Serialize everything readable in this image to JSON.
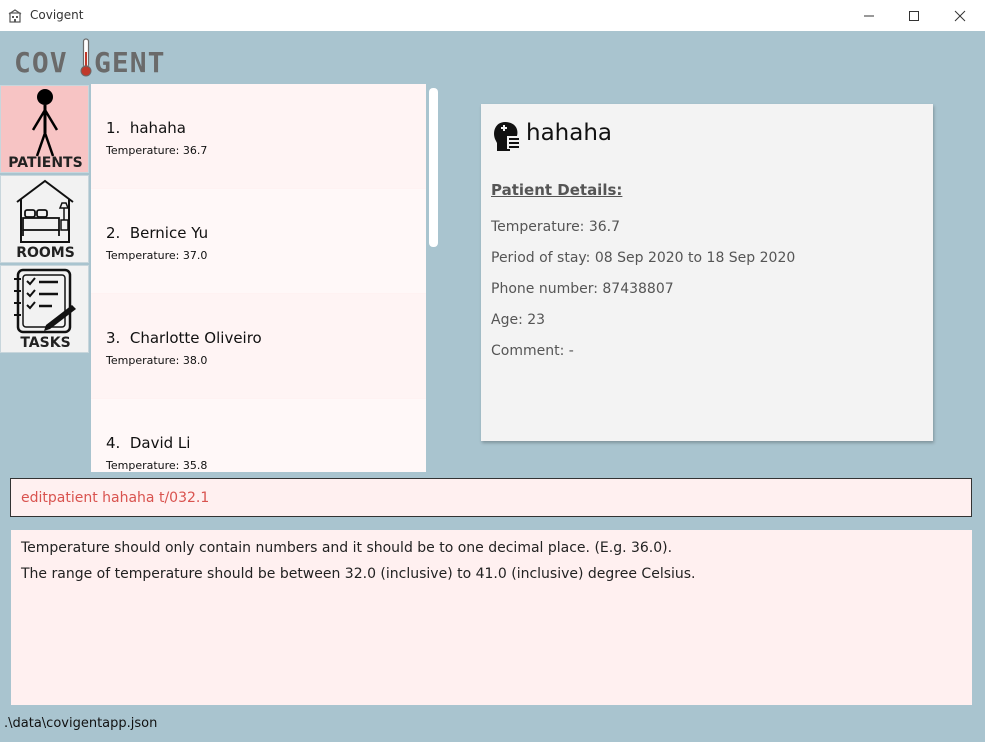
{
  "window": {
    "title": "Covigent",
    "icon": "building-icon",
    "controls": [
      "minimize-icon",
      "maximize-icon",
      "close-icon"
    ]
  },
  "logo": {
    "text_left": "COV",
    "text_right": "GENT",
    "icon": "thermometer-icon"
  },
  "sidebar": {
    "items": [
      {
        "label": "PATIENTS",
        "icon": "person-icon",
        "active": true
      },
      {
        "label": "ROOMS",
        "icon": "bed-room-icon",
        "active": false
      },
      {
        "label": "TASKS",
        "icon": "checklist-icon",
        "active": false
      }
    ]
  },
  "patients": [
    {
      "index": "1.",
      "name": "hahaha",
      "temperature": "Temperature: 36.7"
    },
    {
      "index": "2.",
      "name": "Bernice Yu",
      "temperature": "Temperature: 37.0"
    },
    {
      "index": "3.",
      "name": "Charlotte Oliveiro",
      "temperature": "Temperature: 38.0"
    },
    {
      "index": "4.",
      "name": "David Li",
      "temperature": "Temperature: 35.8"
    }
  ],
  "detail": {
    "icon": "patient-head-icon",
    "name": "hahaha",
    "heading": "Patient Details:",
    "temperature": "Temperature: 36.7",
    "period": "Period of stay: 08 Sep 2020 to 18 Sep 2020",
    "phone": "Phone number: 87438807",
    "age": "Age: 23",
    "comment": "Comment: -"
  },
  "command": {
    "value": "editpatient hahaha t/032.1"
  },
  "result": {
    "line1": "Temperature should only contain numbers and it should be to one decimal place. (E.g. 36.0).",
    "line2": "The range of temperature should be between 32.0 (inclusive) to 41.0 (inclusive) degree Celsius."
  },
  "status": {
    "path": ".\\data\\covigentapp.json"
  },
  "colors": {
    "background": "#a9c4cf",
    "active_tab": "#f7c4c4",
    "list_bg": "#fff4f4",
    "command_text": "#d9534f",
    "thermometer": "#c0392b"
  }
}
